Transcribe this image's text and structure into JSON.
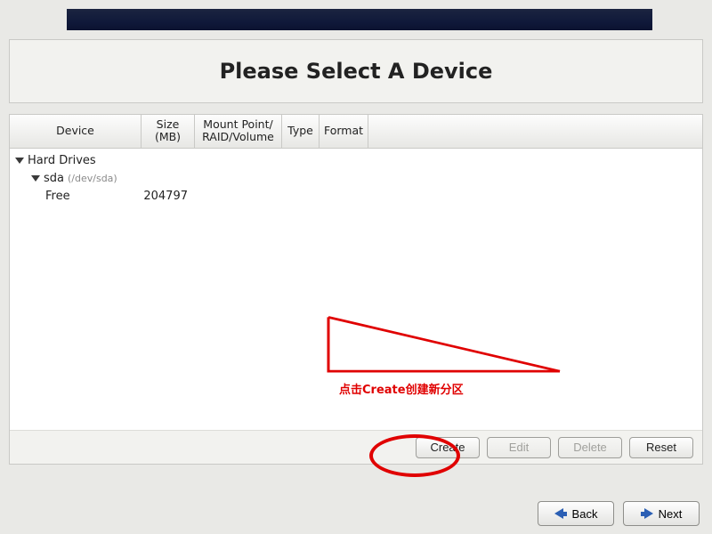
{
  "title": "Please Select A Device",
  "columns": {
    "device": "Device",
    "size": "Size\n(MB)",
    "mount": "Mount Point/\nRAID/Volume",
    "type": "Type",
    "format": "Format"
  },
  "tree": {
    "root_label": "Hard Drives",
    "disk_label": "sda",
    "disk_aux": "(/dev/sda)",
    "free_label": "Free",
    "free_size": "204797"
  },
  "buttons": {
    "create": "Create",
    "edit": "Edit",
    "delete": "Delete",
    "reset": "Reset"
  },
  "nav": {
    "back": "Back",
    "next": "Next"
  },
  "annotation": {
    "text": "点击Create创建新分区"
  }
}
